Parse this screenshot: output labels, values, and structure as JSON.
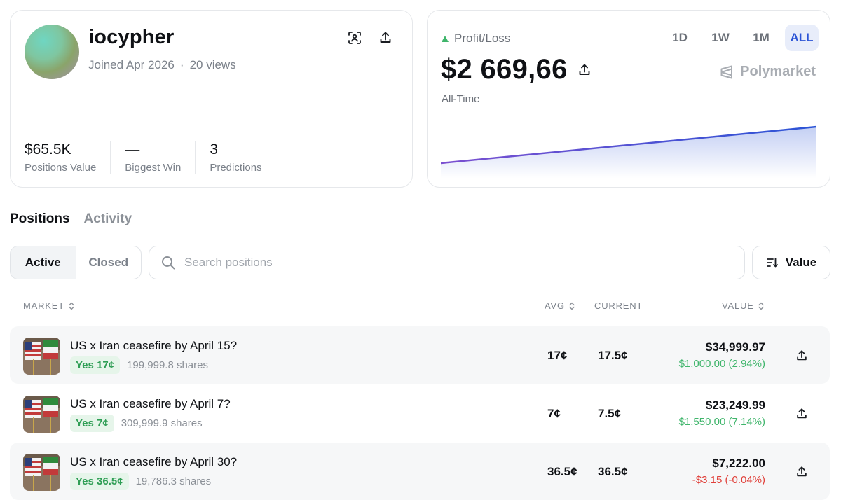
{
  "profile": {
    "username": "iocypher",
    "joined": "Joined Apr 2026",
    "views": "20 views",
    "stats": [
      {
        "value": "$65.5K",
        "label": "Positions Value"
      },
      {
        "value": "—",
        "label": "Biggest Win"
      },
      {
        "value": "3",
        "label": "Predictions"
      }
    ]
  },
  "pnl": {
    "label": "Profit/Loss",
    "value": "$2 669,66",
    "period": "All-Time",
    "ranges": [
      "1D",
      "1W",
      "1M",
      "ALL"
    ],
    "active_range": "ALL",
    "brand": "Polymarket",
    "accent": "#2b54d6",
    "up_color": "#3fb56b",
    "trend": [
      0,
      0.5
    ]
  },
  "tabs": {
    "positions": "Positions",
    "activity": "Activity"
  },
  "filter": {
    "active": "Active",
    "closed": "Closed"
  },
  "search": {
    "placeholder": "Search positions"
  },
  "sort": {
    "label": "Value"
  },
  "table": {
    "headers": {
      "market": "MARKET",
      "avg": "AVG",
      "current": "CURRENT",
      "value": "VALUE"
    },
    "rows": [
      {
        "title": "US x Iran ceasefire by April 15?",
        "outcome": "Yes 17¢",
        "shares": "199,999.8 shares",
        "avg": "17¢",
        "current": "17.5¢",
        "value": "$34,999.97",
        "change": "$1,000.00 (2.94%)",
        "positive": true
      },
      {
        "title": "US x Iran ceasefire by April 7?",
        "outcome": "Yes 7¢",
        "shares": "309,999.9 shares",
        "avg": "7¢",
        "current": "7.5¢",
        "value": "$23,249.99",
        "change": "$1,550.00 (7.14%)",
        "positive": true
      },
      {
        "title": "US x Iran ceasefire by April 30?",
        "outcome": "Yes 36.5¢",
        "shares": "19,786.3 shares",
        "avg": "36.5¢",
        "current": "36.5¢",
        "value": "$7,222.00",
        "change": "-$3.15 (-0.04%)",
        "positive": false
      }
    ]
  }
}
